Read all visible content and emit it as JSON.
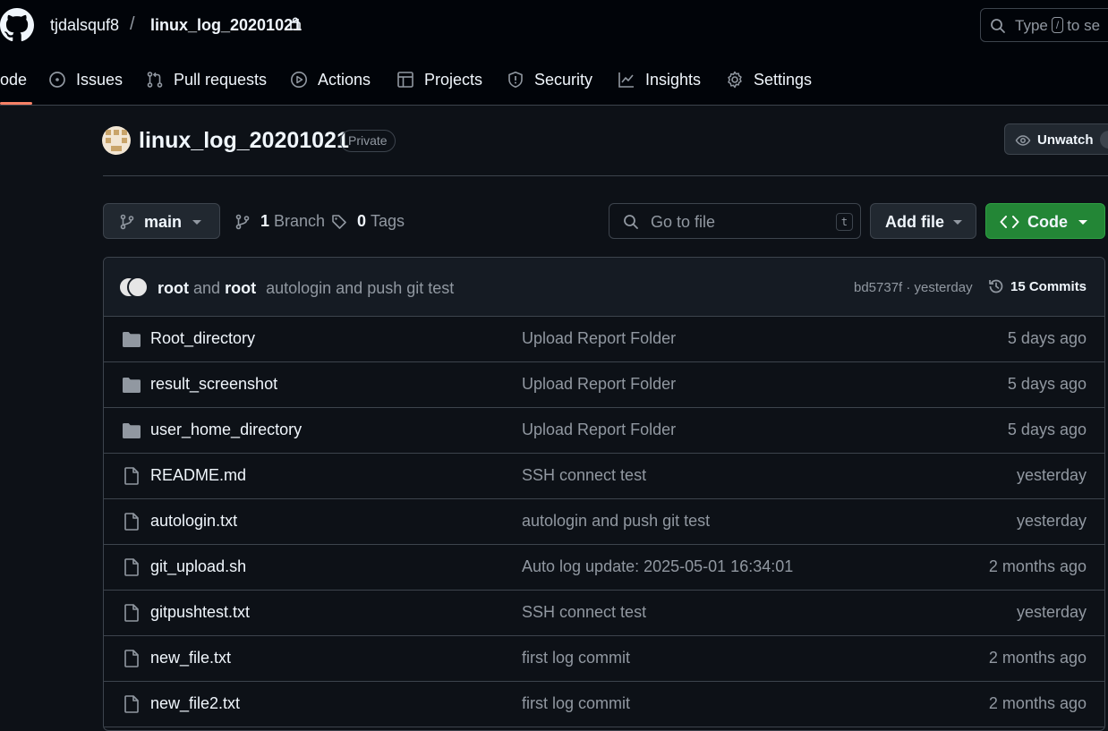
{
  "header": {
    "owner": "tjdalsquf8",
    "separator": "/",
    "repo": "linux_log_20201021",
    "search_before": "Type",
    "search_key": "/",
    "search_after": "to se"
  },
  "nav": {
    "tabs": [
      {
        "label": "ode",
        "icon": "code-icon"
      },
      {
        "label": "Issues",
        "icon": "issue-icon"
      },
      {
        "label": "Pull requests",
        "icon": "pull-request-icon"
      },
      {
        "label": "Actions",
        "icon": "play-icon"
      },
      {
        "label": "Projects",
        "icon": "table-icon"
      },
      {
        "label": "Security",
        "icon": "shield-icon"
      },
      {
        "label": "Insights",
        "icon": "graph-icon"
      },
      {
        "label": "Settings",
        "icon": "gear-icon"
      }
    ]
  },
  "repo": {
    "title": "linux_log_20201021",
    "visibility": "Private",
    "unwatch_label": "Unwatch"
  },
  "toolbar": {
    "branch": "main",
    "branch_count": "1",
    "branch_label": "Branch",
    "tag_count": "0",
    "tag_label": "Tags",
    "goto_placeholder": "Go to file",
    "goto_key": "t",
    "add_file_label": "Add file",
    "code_label": "Code"
  },
  "commit": {
    "author1": "root",
    "joiner": "and",
    "author2": "root",
    "message": "autologin and push git test",
    "sha_time": "bd5737f · yesterday",
    "count_label": "15 Commits"
  },
  "files": [
    {
      "name": "Root_directory",
      "type": "folder",
      "message": "Upload Report Folder",
      "date": "5 days ago"
    },
    {
      "name": "result_screenshot",
      "type": "folder",
      "message": "Upload Report Folder",
      "date": "5 days ago"
    },
    {
      "name": "user_home_directory",
      "type": "folder",
      "message": "Upload Report Folder",
      "date": "5 days ago"
    },
    {
      "name": "README.md",
      "type": "file",
      "message": "SSH connect test",
      "date": "yesterday"
    },
    {
      "name": "autologin.txt",
      "type": "file",
      "message": "autologin and push git test",
      "date": "yesterday"
    },
    {
      "name": "git_upload.sh",
      "type": "file",
      "message": "Auto log update: 2025-05-01 16:34:01",
      "date": "2 months ago"
    },
    {
      "name": "gitpushtest.txt",
      "type": "file",
      "message": "SSH connect test",
      "date": "yesterday"
    },
    {
      "name": "new_file.txt",
      "type": "file",
      "message": "first log commit",
      "date": "2 months ago"
    },
    {
      "name": "new_file2.txt",
      "type": "file",
      "message": "first log commit",
      "date": "2 months ago"
    }
  ],
  "colors": {
    "background": "#0d1117",
    "header_bg": "#010409",
    "border": "#3d444d",
    "text": "#f0f6fc",
    "muted": "#9198a1",
    "accent_underline": "#f78166",
    "code_button": "#238636"
  }
}
